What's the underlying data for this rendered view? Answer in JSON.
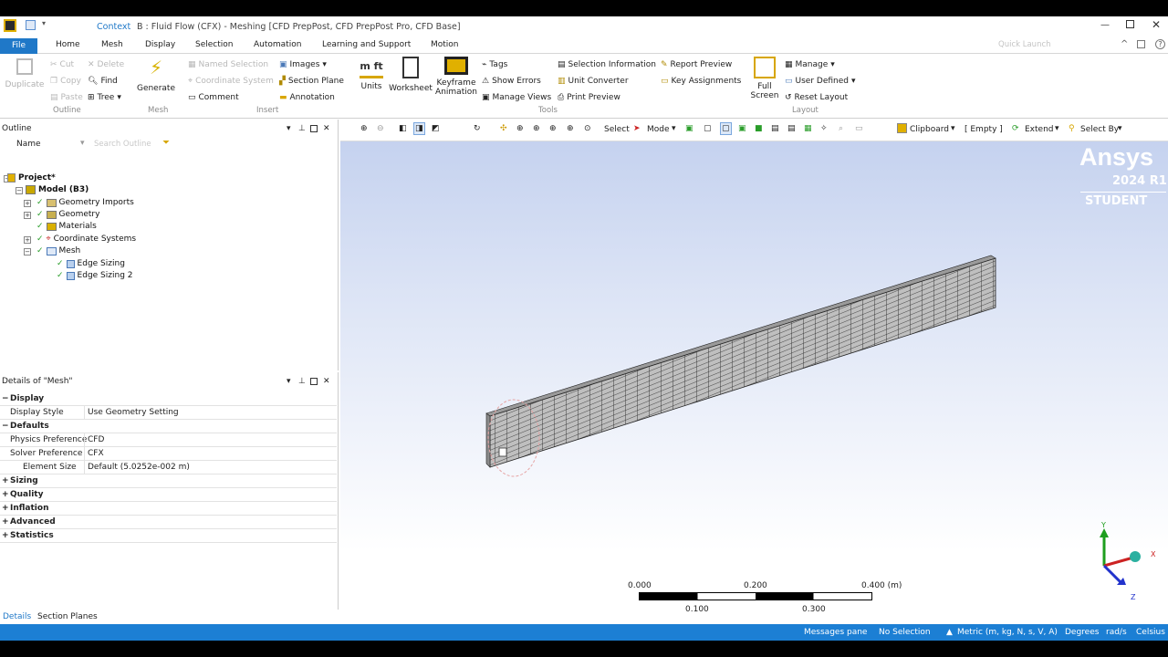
{
  "titlebar": {
    "context_tab": "Context",
    "title": "B : Fluid Flow (CFX) - Meshing [CFD PrepPost, CFD PrepPost Pro, CFD Base]"
  },
  "ribbon_tabs": {
    "file": "File",
    "tabs": [
      "Home",
      "Mesh",
      "Display",
      "Selection",
      "Automation",
      "Learning and Support",
      "Motion"
    ],
    "quick_launch": "Quick Launch"
  },
  "ribbon": {
    "duplicate": "Duplicate",
    "cut": "Cut",
    "copy": "Copy",
    "paste": "Paste",
    "delete": "Delete",
    "find": "Find",
    "tree": "Tree",
    "generate": "Generate",
    "named_selection": "Named Selection",
    "coordinate_system": "Coordinate System",
    "comment": "Comment",
    "images": "Images",
    "section_plane": "Section Plane",
    "annotation": "Annotation",
    "units": "Units",
    "worksheet": "Worksheet",
    "keyframe_animation_1": "Keyframe",
    "keyframe_animation_2": "Animation",
    "tags": "Tags",
    "show_errors": "Show Errors",
    "manage_views": "Manage Views",
    "selection_information": "Selection Information",
    "unit_converter": "Unit Converter",
    "print_preview": "Print Preview",
    "report_preview": "Report Preview",
    "key_assignments": "Key Assignments",
    "full_screen_1": "Full",
    "full_screen_2": "Screen",
    "manage": "Manage",
    "user_defined": "User Defined",
    "reset_layout": "Reset Layout",
    "groups": {
      "outline": "Outline",
      "mesh": "Mesh",
      "insert": "Insert",
      "tools": "Tools",
      "layout": "Layout"
    }
  },
  "outline": {
    "title": "Outline",
    "name_col": "Name",
    "search_placeholder": "Search Outline",
    "tree": {
      "project": "Project*",
      "model": "Model (B3)",
      "geometry_imports": "Geometry Imports",
      "geometry": "Geometry",
      "materials": "Materials",
      "coordinate_systems": "Coordinate Systems",
      "mesh": "Mesh",
      "edge_sizing": "Edge Sizing",
      "edge_sizing_2": "Edge Sizing 2"
    }
  },
  "details": {
    "title": "Details of \"Mesh\"",
    "display": "Display",
    "display_style_k": "Display Style",
    "display_style_v": "Use Geometry Setting",
    "defaults": "Defaults",
    "physics_k": "Physics Preference",
    "physics_v": "CFD",
    "solver_k": "Solver Preference",
    "solver_v": "CFX",
    "element_k": "Element Size",
    "element_v": "Default (5.0252e-002 m)",
    "sizing": "Sizing",
    "quality": "Quality",
    "inflation": "Inflation",
    "advanced": "Advanced",
    "statistics": "Statistics"
  },
  "bottom_tabs": {
    "details": "Details",
    "section_planes": "Section Planes"
  },
  "graphics_toolbar": {
    "select": "Select",
    "mode": "Mode",
    "clipboard": "Clipboard",
    "empty": "[ Empty ]",
    "extend": "Extend",
    "select_by": "Select By"
  },
  "brand": {
    "name": "Ansys",
    "version": "2024 R1",
    "edition": "STUDENT"
  },
  "scale": {
    "t0": "0.000",
    "t2": "0.200",
    "t4": "0.400 (m)",
    "t1": "0.100",
    "t3": "0.300"
  },
  "triad": {
    "x": "X",
    "y": "Y",
    "z": "Z"
  },
  "status": {
    "messages": "Messages pane",
    "selection": "No Selection",
    "units": "Metric (m, kg, N, s, V, A)",
    "degrees": "Degrees",
    "rads": "rad/s",
    "temp": "Celsius"
  },
  "colors": {
    "accent": "#1c7fd4",
    "ribbon_file": "#1f78c8",
    "check": "#2a9d2a"
  }
}
